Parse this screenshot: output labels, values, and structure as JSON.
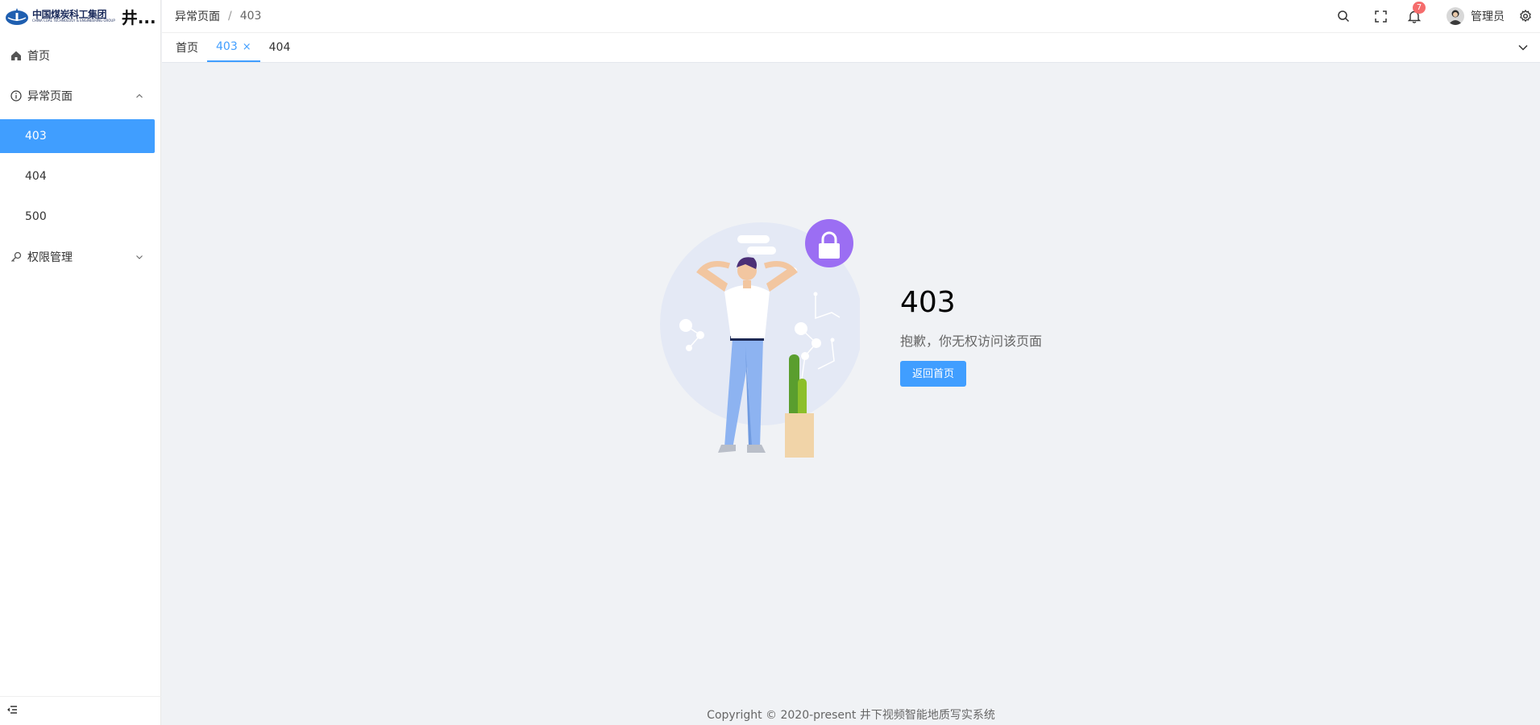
{
  "app": {
    "title": "井...",
    "logo_cn": "中国煤炭科工集团",
    "logo_en": "CHINA COAL TECHNOLOGY & ENGINEERING GROUP"
  },
  "sidebar": {
    "items": [
      {
        "label": "首页",
        "icon": "home-icon"
      },
      {
        "label": "异常页面",
        "icon": "info-circle-icon",
        "expanded": true,
        "children": [
          {
            "label": "403",
            "active": true
          },
          {
            "label": "404",
            "active": false
          },
          {
            "label": "500",
            "active": false
          }
        ]
      },
      {
        "label": "权限管理",
        "icon": "key-icon",
        "expanded": false
      }
    ]
  },
  "breadcrumb": {
    "parent": "异常页面",
    "separator": "/",
    "current": "403"
  },
  "header": {
    "notification_count": "7",
    "username": "管理员"
  },
  "tabs": [
    {
      "label": "首页",
      "active": false
    },
    {
      "label": "403",
      "active": true,
      "closable": true,
      "close_glyph": "×"
    },
    {
      "label": "404",
      "active": false
    }
  ],
  "error": {
    "code": "403",
    "message": "抱歉，你无权访问该页面",
    "button_label": "返回首页"
  },
  "footer": {
    "copyright": "Copyright © 2020-present 井下视频智能地质写实系统"
  },
  "colors": {
    "primary": "#409eff",
    "badge": "#f56c6c",
    "background": "#f0f2f5",
    "lock": "#9b6ef3"
  }
}
